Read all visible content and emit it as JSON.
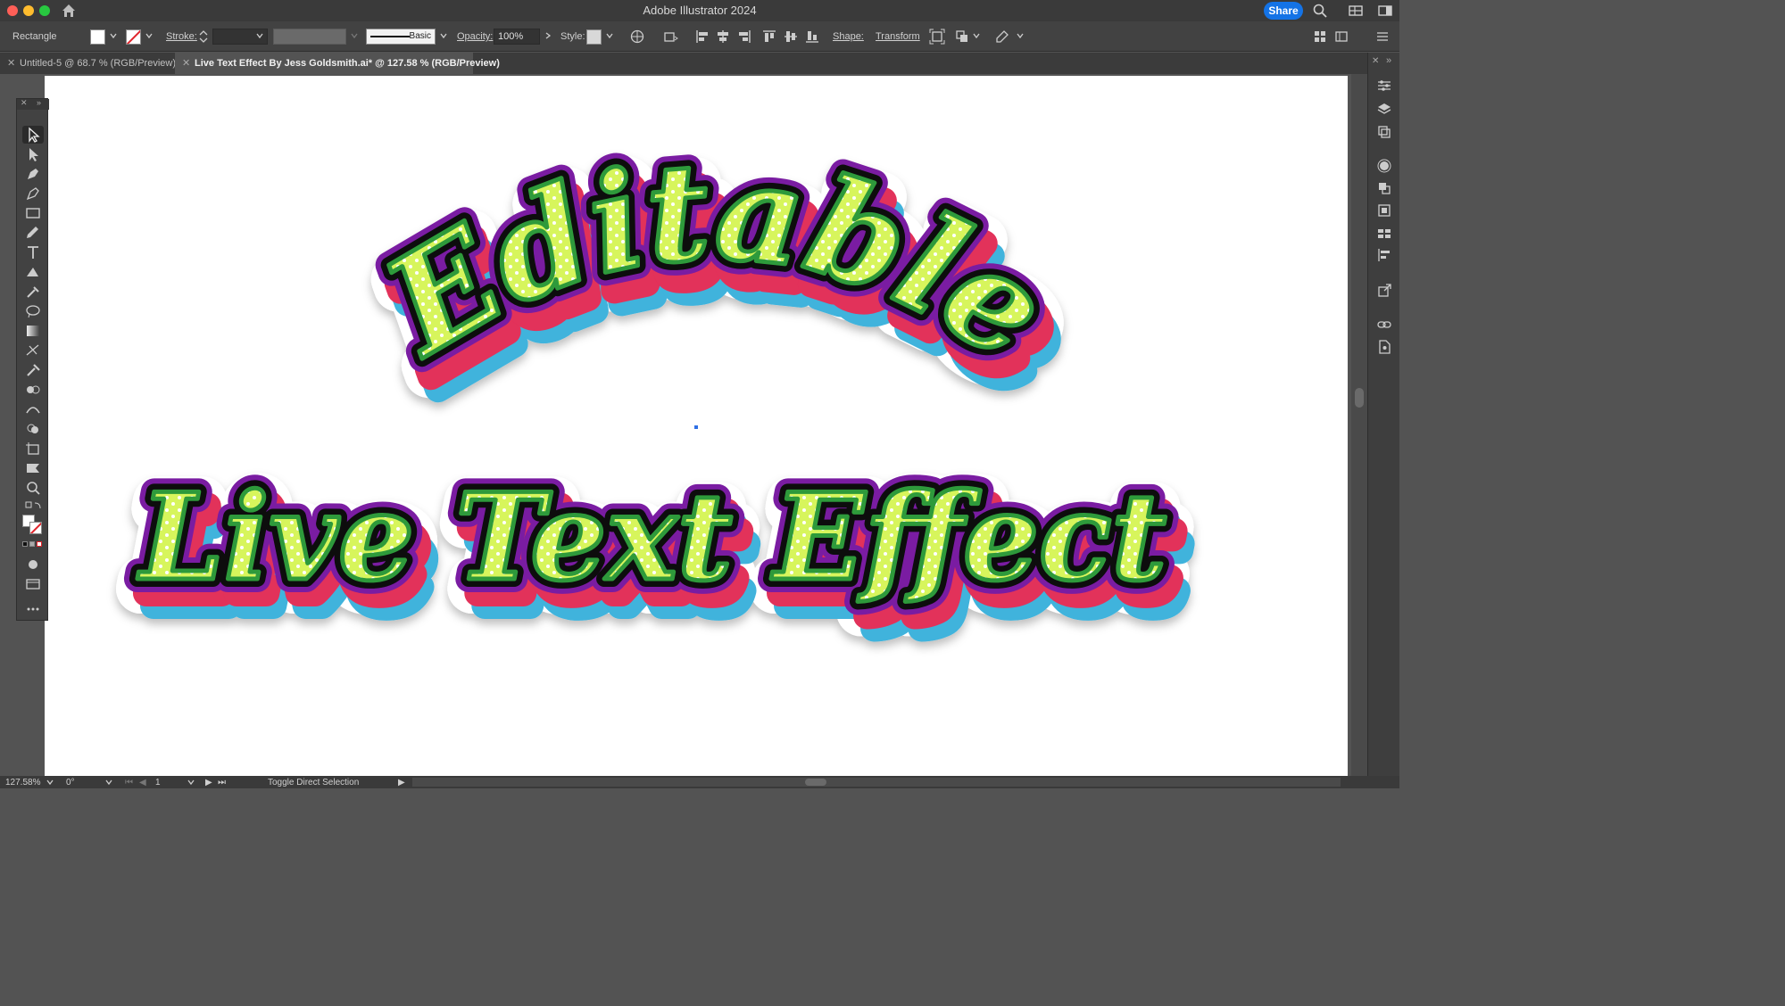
{
  "app": {
    "title": "Adobe Illustrator 2024",
    "share_label": "Share",
    "accent": "#1473e6"
  },
  "control_bar": {
    "selection_type": "Rectangle",
    "stroke_label": "Stroke:",
    "stroke_profile": "Basic",
    "opacity_label": "Opacity:",
    "opacity_value": "100%",
    "style_label": "Style:",
    "shape_label": "Shape:",
    "transform_label": "Transform"
  },
  "tabs": [
    {
      "label": "Untitled-5 @ 68.7 % (RGB/Preview)",
      "active": false
    },
    {
      "label": "Live Text Effect By Jess Goldsmith.ai* @ 127.58 % (RGB/Preview)",
      "active": true
    }
  ],
  "artwork": {
    "line1": "Editable",
    "line2": "Live Text Effect",
    "colors": {
      "fill": "#d7f55b",
      "dots": "#ffffff",
      "inner_outline": "#2e9a3a",
      "black_outline": "#0a0a0a",
      "purple": "#7a1fa2",
      "red": "#e2305a",
      "blue": "#3fb3dc",
      "sticker": "#ffffff"
    }
  },
  "tools": [
    "selection-tool",
    "direct-selection-tool",
    "pen-tool",
    "curvature-tool",
    "rectangle-tool",
    "pencil-tool",
    "type-tool",
    "shaper-tool",
    "eyedropper-tool",
    "lasso-tool",
    "gradient-tool",
    "mesh-tool",
    "eyedropper-2-tool",
    "blend-tool",
    "width-tool",
    "shape-builder-tool",
    "artboard-tool",
    "slice-tool",
    "zoom-tool"
  ],
  "status_bar": {
    "zoom": "127.58%",
    "rotation": "0°",
    "artboard_number": "1",
    "status_text": "Toggle Direct Selection"
  }
}
